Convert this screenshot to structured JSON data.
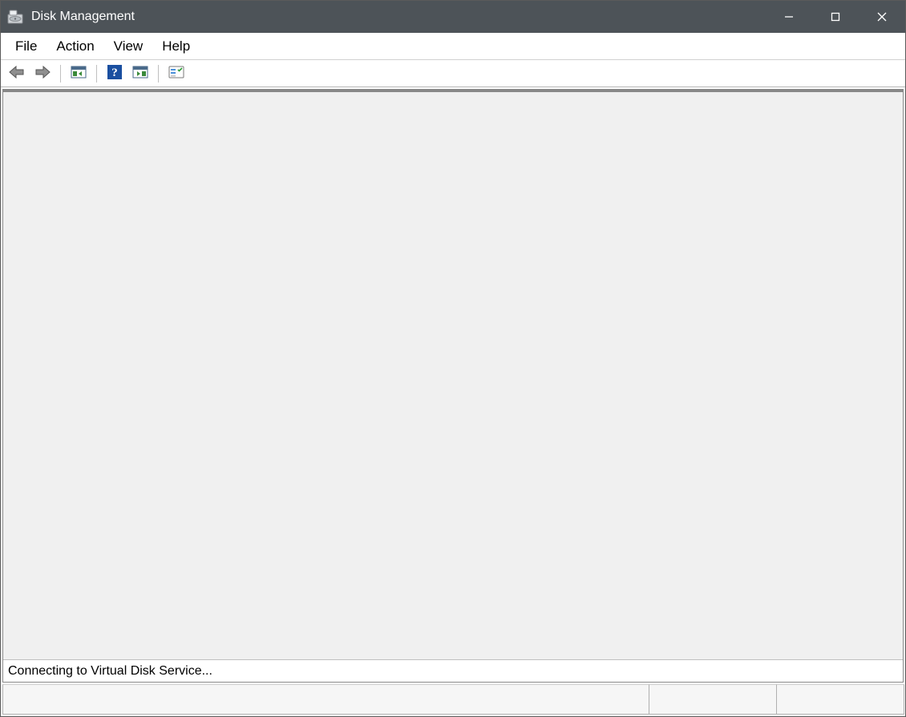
{
  "window": {
    "title": "Disk Management"
  },
  "menu": {
    "file": "File",
    "action": "Action",
    "view": "View",
    "help": "Help"
  },
  "toolbar": {
    "back_icon": "back-arrow",
    "forward_icon": "forward-arrow",
    "show_tree_icon": "show-tree",
    "help_icon": "help",
    "details_icon": "details-view",
    "properties_icon": "properties"
  },
  "status": {
    "message": "Connecting to Virtual Disk Service..."
  }
}
